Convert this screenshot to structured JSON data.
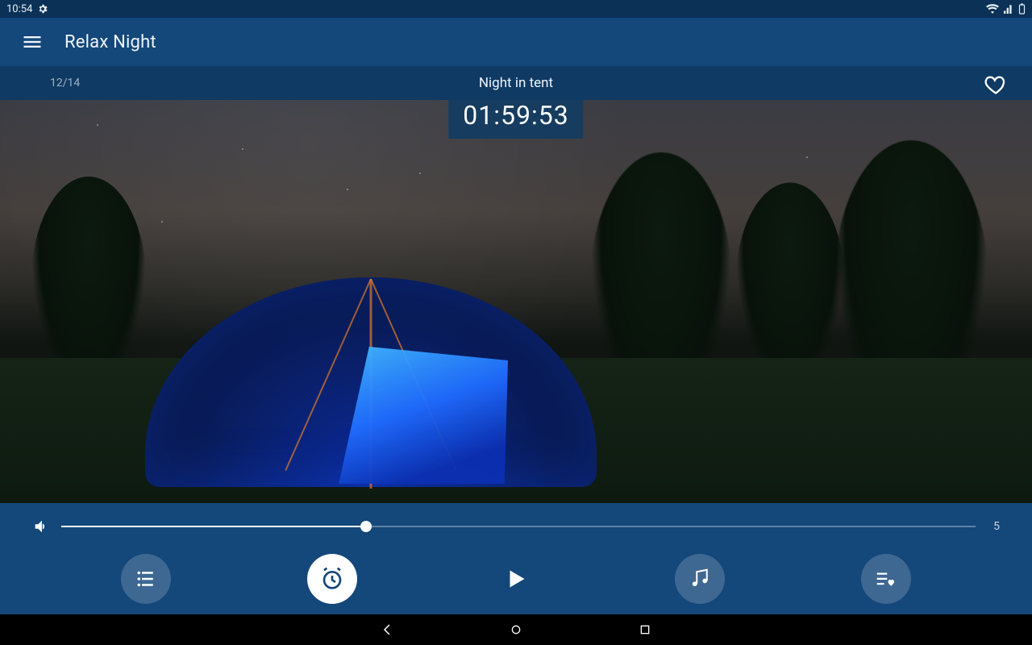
{
  "status": {
    "time": "10:54"
  },
  "appbar": {
    "title": "Relax Night"
  },
  "player": {
    "counter": "12/14",
    "track_title": "Night in tent",
    "timer": "01:59:53"
  },
  "volume": {
    "value": 5,
    "max": 15,
    "label": "5"
  }
}
